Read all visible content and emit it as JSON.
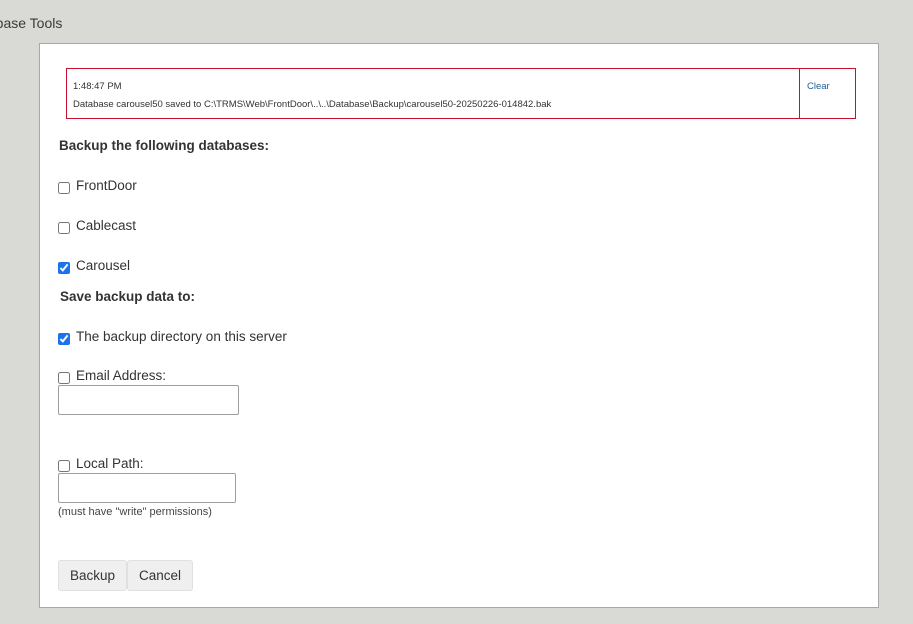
{
  "page": {
    "heading": "tabase Tools"
  },
  "message": {
    "time": "1:48:47 PM",
    "text": "Database carousel50 saved to C:\\TRMS\\Web\\FrontDoor\\..\\..\\Database\\Backup\\carousel50-20250226-014842.bak",
    "clear_label": "Clear"
  },
  "backup_section": {
    "title": "Backup the following databases:",
    "databases": [
      {
        "label": "FrontDoor",
        "checked": false
      },
      {
        "label": "Cablecast",
        "checked": false
      },
      {
        "label": "Carousel",
        "checked": true
      }
    ]
  },
  "save_section": {
    "title": "Save backup data to:",
    "server_dir_label": "The backup directory on this server",
    "server_dir_checked": true,
    "email_label": "Email Address:",
    "email_checked": false,
    "email_value": "",
    "local_path_label": "Local Path:",
    "local_path_checked": false,
    "local_path_value": "",
    "local_path_hint": "(must have \"write\" permissions)"
  },
  "buttons": {
    "backup_label": "Backup",
    "cancel_label": "Cancel"
  },
  "colors": {
    "background": "#d9d9d6",
    "message_border": "#c8102e",
    "link": "#1f5f99"
  }
}
